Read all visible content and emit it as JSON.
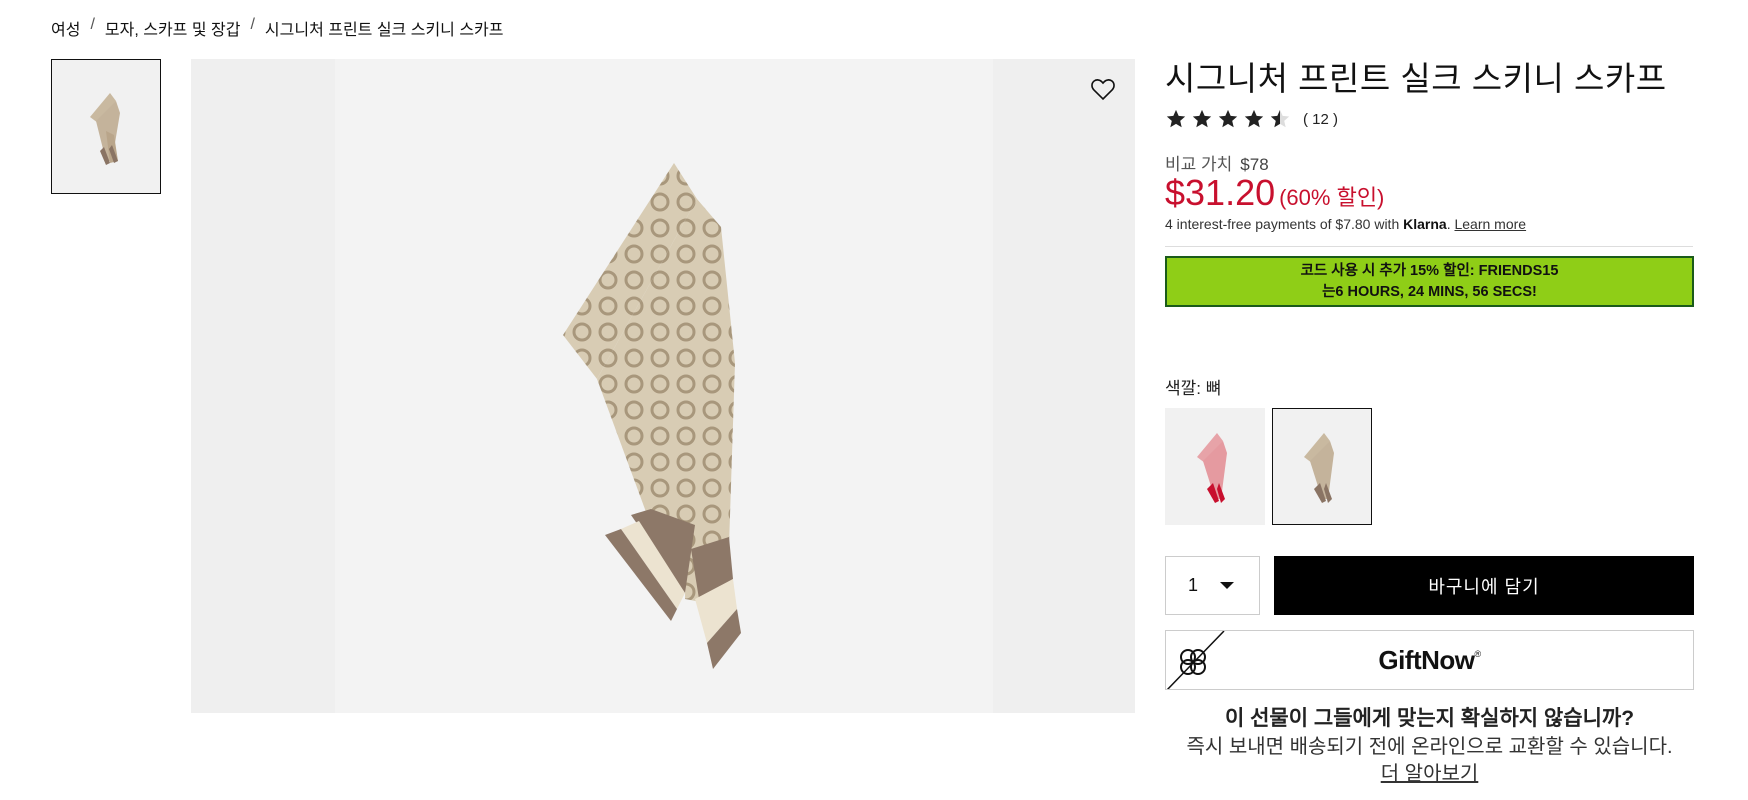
{
  "breadcrumb": {
    "items": [
      "여성",
      "모자, 스카프 및 장갑",
      "시그니처 프린트 실크 스키니 스카프"
    ],
    "separator": "/"
  },
  "product": {
    "title": "시그니처 프린트 실크 스키니 스카프",
    "rating": {
      "stars": 4.5,
      "max": 5,
      "count_text": "( 12 )"
    },
    "compare_label": "비교 가치",
    "compare_price": "$78",
    "price": "$31.20",
    "discount_text": "(60% 할인)",
    "klarna": {
      "prefix": "4 interest-free payments of $7.80 with",
      "brand": "Klarna",
      "period": ".",
      "learn_more": "Learn more"
    },
    "promo": {
      "line1": "코드 사용 시 추가 15% 할인: FRIENDS15",
      "line2": "는6 HOURS, 24 MINS, 56 SECS!",
      "bg_color": "#8fce17"
    },
    "color_label": "색깔: 뼈",
    "swatches": [
      {
        "name": "red-pink",
        "selected": false
      },
      {
        "name": "bone",
        "selected": true
      }
    ],
    "quantity": "1",
    "add_to_bag": "바구니에 담기",
    "giftnow": {
      "logo": "GiftNow",
      "mark": "®"
    },
    "gift_question": "이 선물이 그들에게 맞는지 확실하지 않습니까?",
    "gift_desc": "즉시 보내면 배송되기 전에 온라인으로 교환할 수 있습니다.",
    "gift_more": "더 알아보기"
  },
  "colors": {
    "sale_red": "#c8102e",
    "promo_green": "#8fce17",
    "button_black": "#000000"
  },
  "icons": {
    "wishlist": "heart-outline-icon",
    "giftnow": "bow-icon",
    "quantity": "caret-down-icon"
  }
}
